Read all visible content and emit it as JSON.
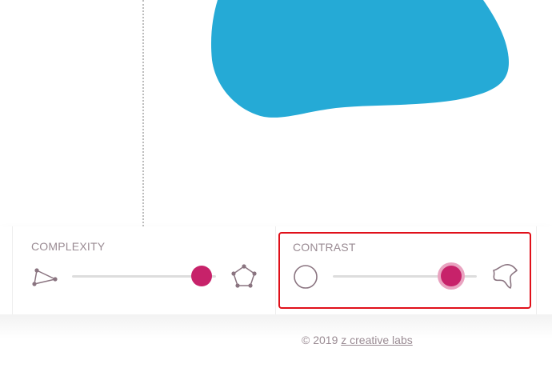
{
  "canvas": {
    "blob_color": "#25aad6",
    "divider_style": "dotted"
  },
  "controls": {
    "complexity": {
      "label": "COMPLEXITY",
      "left_icon": "triangle-nodes-icon",
      "right_icon": "pentagon-nodes-icon",
      "value": 0.9
    },
    "contrast": {
      "label": "CONTRAST",
      "left_icon": "circle-outline-icon",
      "right_icon": "spiky-blob-icon",
      "value": 0.82,
      "selected": true
    }
  },
  "colors": {
    "accent": "#c7226a",
    "accent_ring": "#e9a3c0",
    "selection": "#e0101a",
    "label_text": "#9a8b93",
    "track": "#dddddd"
  },
  "footer": {
    "copyright": "© 2019",
    "link_text": "z creative labs"
  }
}
